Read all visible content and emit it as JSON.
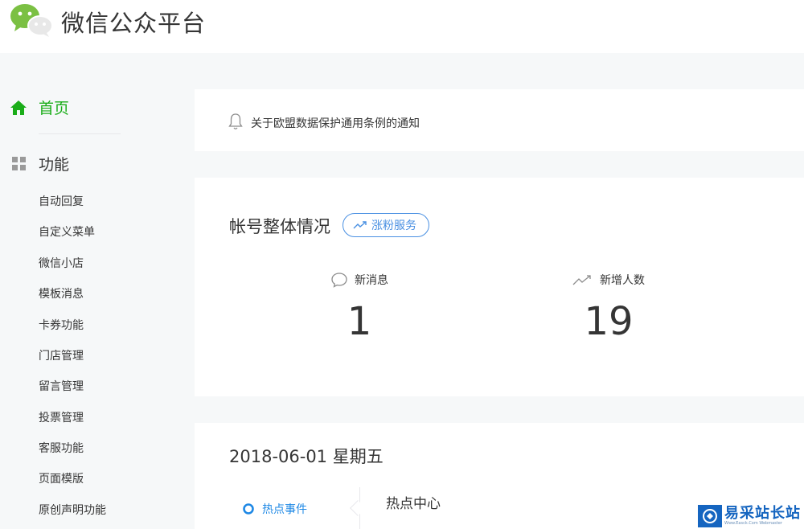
{
  "header": {
    "brand": "微信公众平台"
  },
  "sidebar": {
    "home_label": "首页",
    "function_label": "功能",
    "items": [
      {
        "label": "自动回复"
      },
      {
        "label": "自定义菜单"
      },
      {
        "label": "微信小店"
      },
      {
        "label": "模板消息"
      },
      {
        "label": "卡券功能"
      },
      {
        "label": "门店管理"
      },
      {
        "label": "留言管理"
      },
      {
        "label": "投票管理"
      },
      {
        "label": "客服功能"
      },
      {
        "label": "页面模版"
      },
      {
        "label": "原创声明功能"
      }
    ]
  },
  "notice": {
    "text": "关于欧盟数据保护通用条例的通知"
  },
  "account": {
    "title": "帐号整体情况",
    "service_button": "涨粉服务",
    "stats": {
      "new_messages": {
        "label": "新消息",
        "value": "1"
      },
      "new_followers": {
        "label": "新增人数",
        "value": "19"
      }
    }
  },
  "daily": {
    "date": "2018-06-01 星期五",
    "tab_label": "热点事件",
    "section_title": "热点中心"
  },
  "watermark": {
    "text": "易采站长站",
    "subtext": "Www.Easck.Com Webmaster"
  },
  "colors": {
    "brand_green": "#1aad19",
    "link_blue": "#4a90e2",
    "tab_blue": "#1e88e5",
    "background": "#f6f8f9"
  }
}
